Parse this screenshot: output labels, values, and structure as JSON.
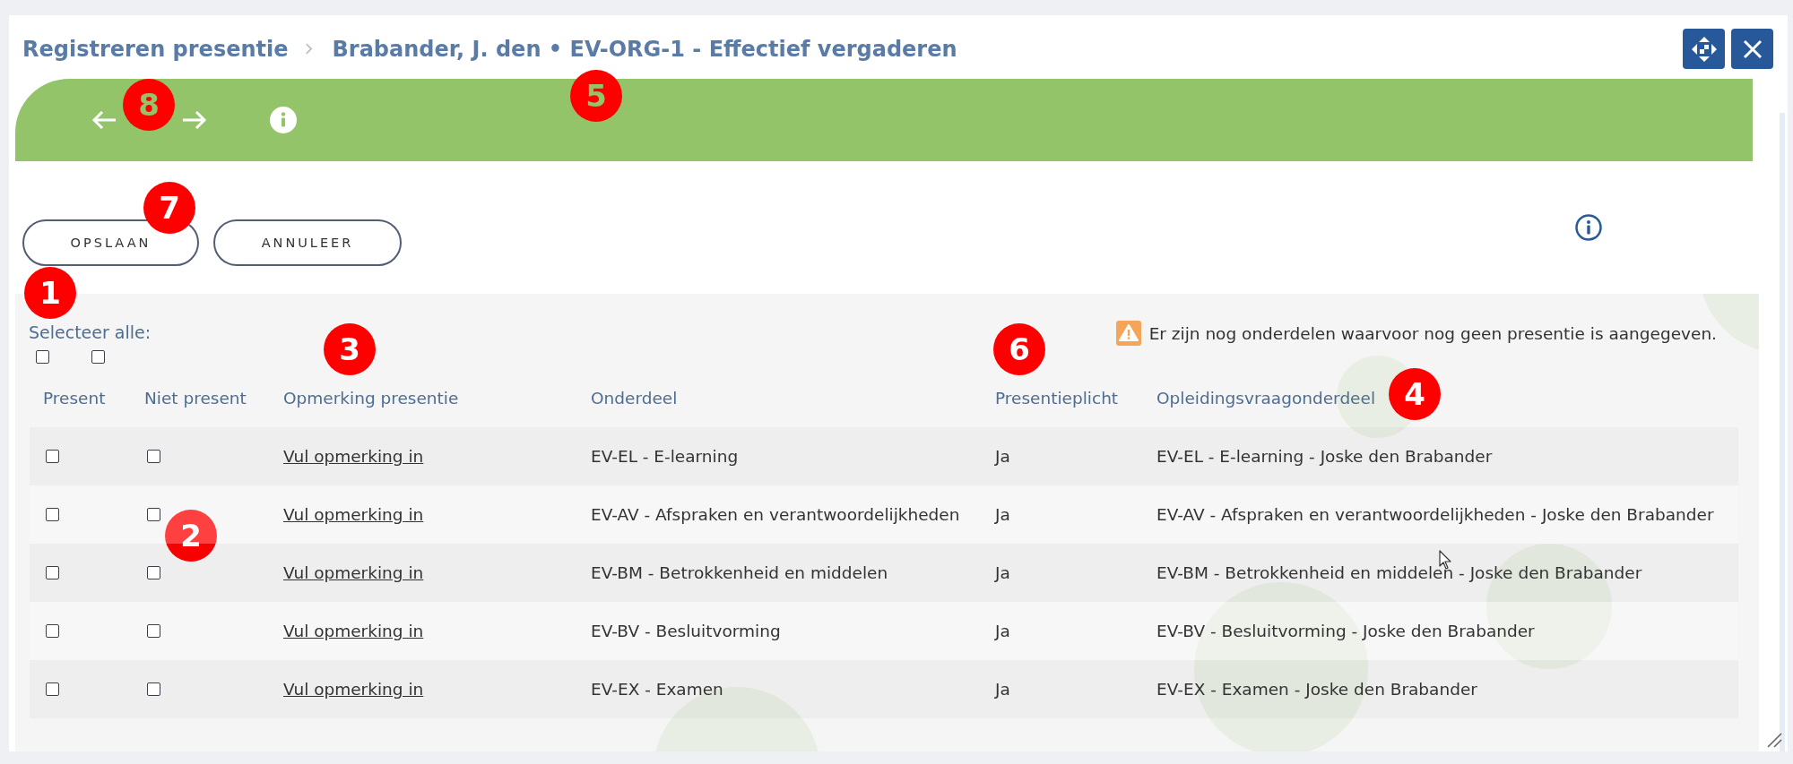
{
  "dialog": {
    "breadcrumb": [
      {
        "label": "Registreren presentie"
      },
      {
        "label": "Brabander, J. den • EV-ORG-1 - Effectief vergaderen"
      }
    ]
  },
  "buttons": [
    {
      "label": "OPSLAAN"
    },
    {
      "label": "ANNULEER"
    }
  ],
  "select_all": {
    "label": "Selecteer alle:",
    "checkboxes": [
      {
        "checked": false
      },
      {
        "checked": false
      }
    ]
  },
  "warning": {
    "text": "Er zijn nog onderdelen waarvoor nog geen presentie is aangegeven."
  },
  "table": {
    "columns": [
      "Present",
      "Niet present",
      "Opmerking presentie",
      "Onderdeel",
      "Presentieplicht",
      "Opleidingsvraagonderdeel"
    ],
    "rows": [
      {
        "present_checked": false,
        "absent_checked": false,
        "comment_link": "Vul opmerking in",
        "part": "EV-EL - E-learning",
        "required": "Ja",
        "course_part": "EV-EL - E-learning - Joske den Brabander"
      },
      {
        "present_checked": false,
        "absent_checked": false,
        "comment_link": "Vul opmerking in",
        "part": "EV-AV - Afspraken en verantwoordelijkheden",
        "required": "Ja",
        "course_part": "EV-AV - Afspraken en verantwoordelijkheden - Joske den Brabander"
      },
      {
        "present_checked": false,
        "absent_checked": false,
        "comment_link": "Vul opmerking in",
        "part": "EV-BM - Betrokkenheid en middelen",
        "required": "Ja",
        "course_part": "EV-BM - Betrokkenheid en middelen - Joske den Brabander"
      },
      {
        "present_checked": false,
        "absent_checked": false,
        "comment_link": "Vul opmerking in",
        "part": "EV-BV - Besluitvorming",
        "required": "Ja",
        "course_part": "EV-BV - Besluitvorming - Joske den Brabander"
      },
      {
        "present_checked": false,
        "absent_checked": false,
        "comment_link": "Vul opmerking in",
        "part": "EV-EX - Examen",
        "required": "Ja",
        "course_part": "EV-EX - Examen - Joske den Brabander"
      }
    ]
  },
  "callouts": [
    {
      "number": "5"
    },
    {
      "number": "8"
    },
    {
      "number": "7"
    },
    {
      "number": "1"
    },
    {
      "number": "3"
    },
    {
      "number": "6"
    },
    {
      "number": "4"
    },
    {
      "number": "2"
    }
  ]
}
